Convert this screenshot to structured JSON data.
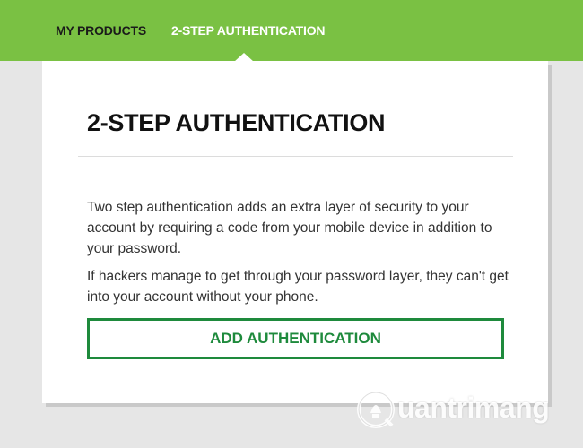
{
  "nav": {
    "items": [
      {
        "label": "MY PRODUCTS"
      },
      {
        "label": "2-STEP AUTHENTICATION",
        "active": true
      }
    ]
  },
  "card": {
    "title": "2-STEP AUTHENTICATION",
    "paragraph1": "Two step authentication adds an extra layer of security to your account by requiring a code from your mobile device in addition to your password.",
    "paragraph2": "If hackers manage to get through your password layer, they can't get into your account without your phone.",
    "button_label": "ADD AUTHENTICATION"
  },
  "watermark": {
    "text": "uantrimang",
    "icon": "quantrimang-logo-icon"
  },
  "colors": {
    "header_green": "#7ac143",
    "button_green": "#1e8a3c",
    "page_bg": "#e6e6e6",
    "card_bg": "#ffffff"
  }
}
